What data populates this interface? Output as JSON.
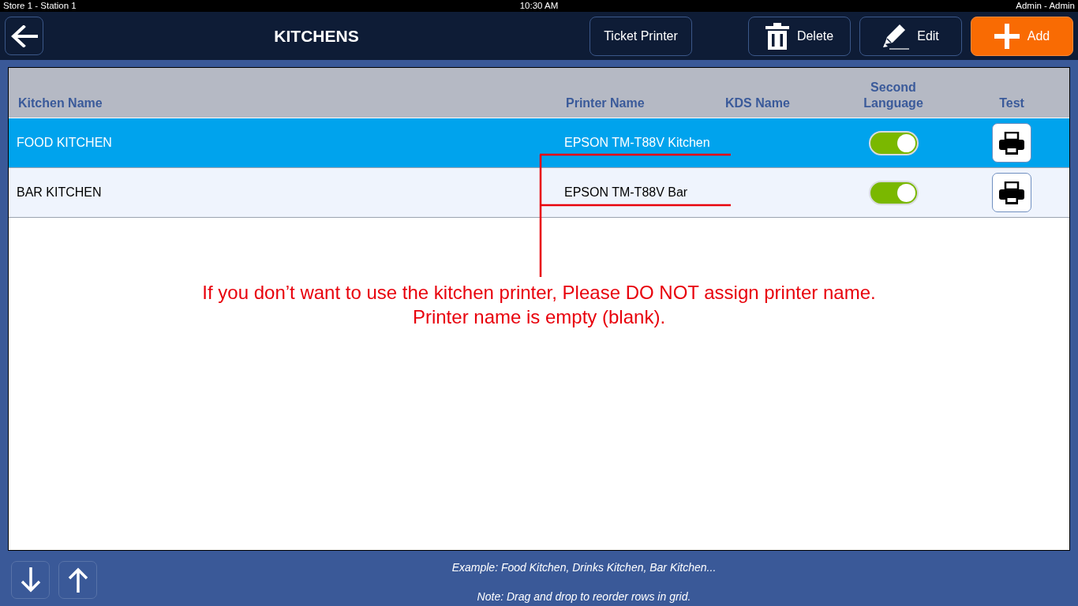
{
  "status_bar": {
    "left": "Store 1 - Station 1",
    "center": "10:30 AM",
    "right": "Admin - Admin"
  },
  "header": {
    "title": "KITCHENS",
    "buttons": [
      {
        "kind": "text",
        "label": "Ticket Printer"
      },
      {
        "kind": "delete",
        "label": "Delete"
      },
      {
        "kind": "edit",
        "label": "Edit"
      },
      {
        "kind": "add",
        "label": "Add"
      }
    ]
  },
  "table": {
    "columns": [
      "Kitchen Name",
      "Printer Name",
      "KDS Name",
      "Second Language",
      "Test"
    ],
    "rows": [
      {
        "kitchen_name": "FOOD KITCHEN",
        "printer_name": "EPSON TM-T88V Kitchen",
        "second_language": true,
        "selected": true
      },
      {
        "kitchen_name": "BAR KITCHEN",
        "printer_name": "EPSON TM-T88V Bar",
        "second_language": true,
        "selected": false
      }
    ]
  },
  "annotation": {
    "lines": [
      "If you don’t want to use the kitchen printer, Please DO NOT assign printer name.",
      "Printer name is empty (blank)."
    ]
  },
  "footer": {
    "notes": [
      "Example: Food Kitchen, Drinks Kitchen, Bar Kitchen...",
      "Note: Drag and drop to reorder rows in grid."
    ]
  }
}
